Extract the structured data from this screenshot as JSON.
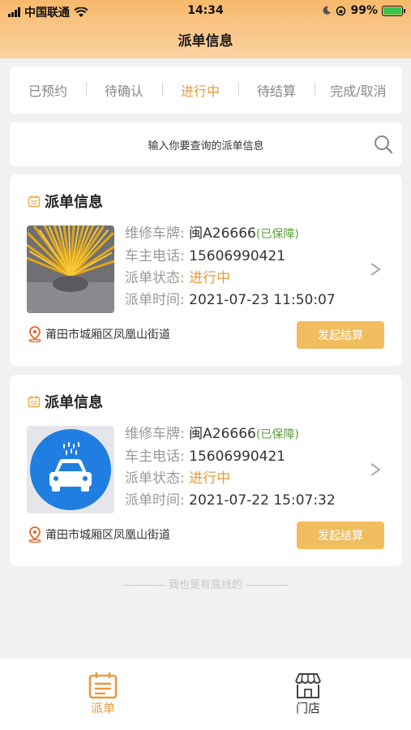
{
  "status_bar": {
    "carrier": "中国联通",
    "time": "14:34",
    "battery": "99%"
  },
  "header": {
    "title": "派单信息"
  },
  "tabs": [
    {
      "label": "已预约",
      "active": false
    },
    {
      "label": "待确认",
      "active": false
    },
    {
      "label": "进行中",
      "active": true
    },
    {
      "label": "待结算",
      "active": false
    },
    {
      "label": "完成/取消",
      "active": false
    }
  ],
  "search": {
    "placeholder": "输入你要查询的派单信息"
  },
  "orders": [
    {
      "title": "派单信息",
      "plate_label": "维修车牌:",
      "plate": "闽A26666",
      "plate_badge": "(已保障)",
      "phone_label": "车主电话:",
      "phone": "15606990421",
      "status_label": "派单状态:",
      "status": "进行中",
      "time_label": "派单时间:",
      "time": "2021-07-23 11:50:07",
      "address": "莆田市城厢区凤凰山街道",
      "button": "发起结算",
      "image": "yellow-flower-photo"
    },
    {
      "title": "派单信息",
      "plate_label": "维修车牌:",
      "plate": "闽A26666",
      "plate_badge": "(已保障)",
      "phone_label": "车主电话:",
      "phone": "15606990421",
      "status_label": "派单状态:",
      "status": "进行中",
      "time_label": "派单时间:",
      "time": "2021-07-22 15:07:32",
      "address": "莆田市城厢区凤凰山街道",
      "button": "发起结算",
      "image": "car-wash-icon"
    }
  ],
  "footer_text": "———— 我也是有底线的 ————",
  "tab_bar": [
    {
      "label": "派单",
      "icon": "order-icon",
      "active": true
    },
    {
      "label": "门店",
      "icon": "store-icon",
      "active": false
    }
  ],
  "colors": {
    "accent": "#e69a3a",
    "button": "#f0bd5f",
    "badge_green": "#5a9e3a"
  }
}
